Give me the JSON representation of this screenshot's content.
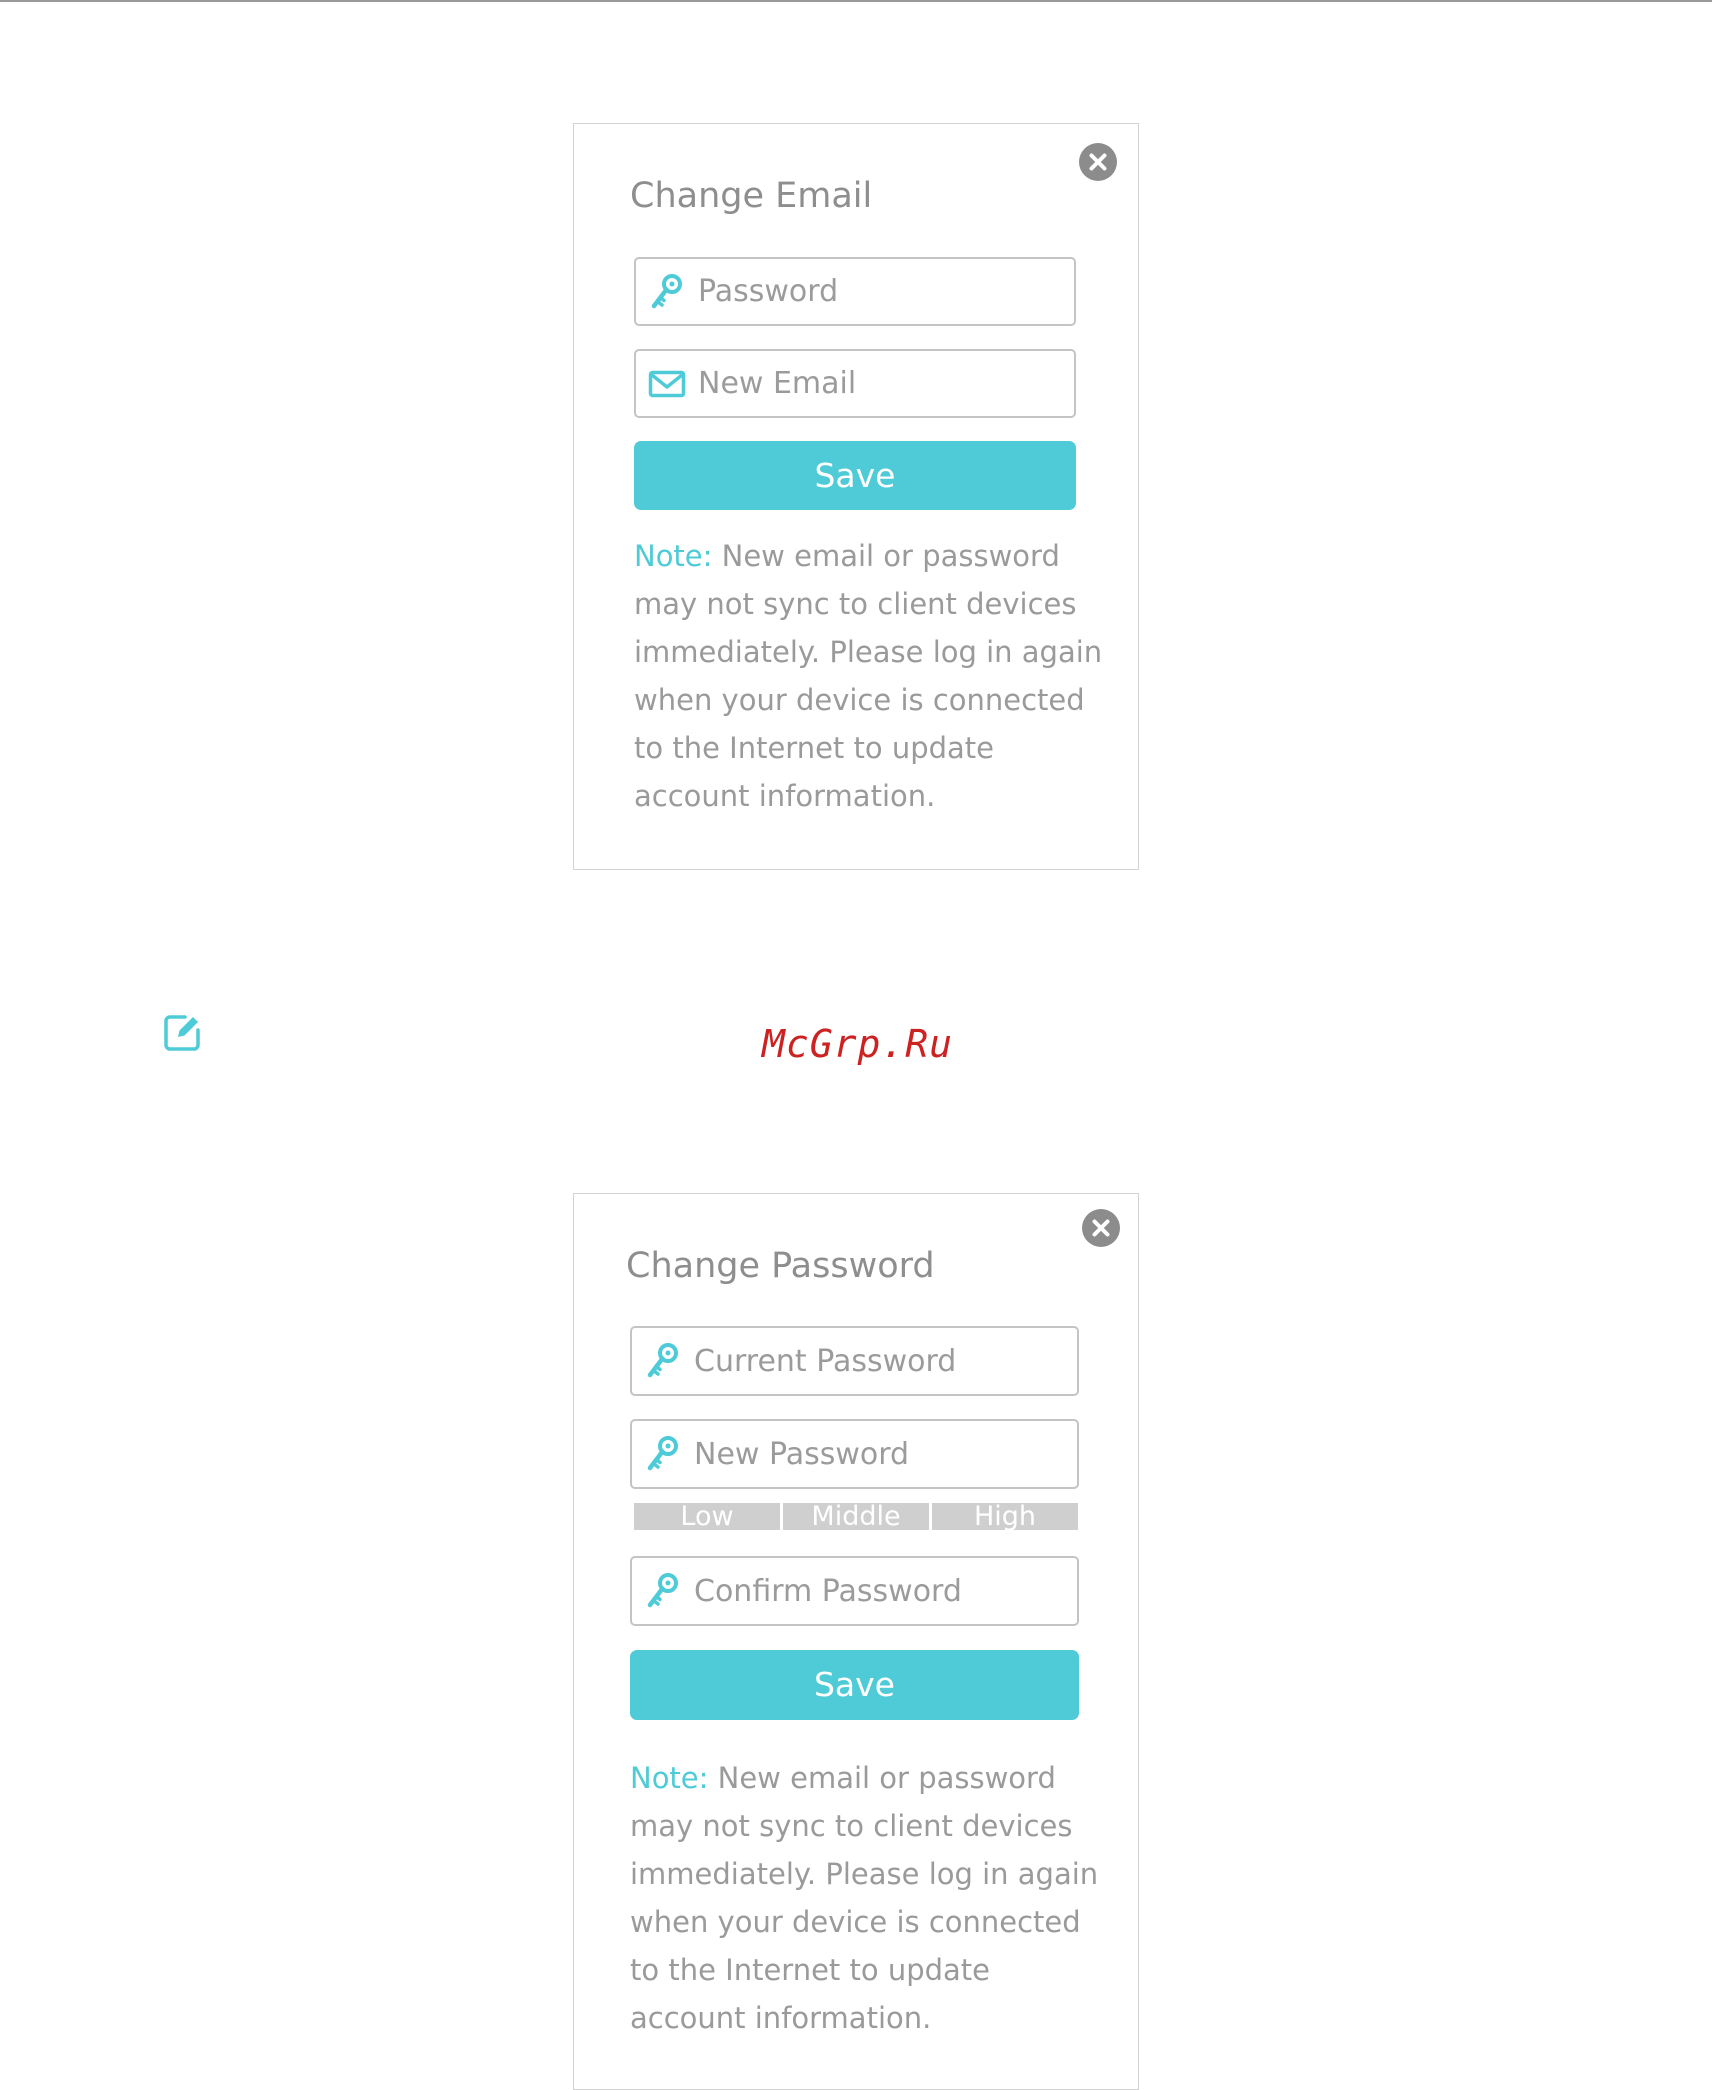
{
  "email_dialog": {
    "title": "Change Email",
    "close_icon": "close-icon",
    "fields": {
      "password": {
        "placeholder": "Password",
        "value": "",
        "icon": "key-icon"
      },
      "new_email": {
        "placeholder": "New Email",
        "value": "",
        "icon": "envelope-icon"
      }
    },
    "save_label": "Save",
    "note": {
      "label": "Note:",
      "lines": [
        " New email or password",
        "may not sync to client devices",
        "immediately. Please log in again",
        "when your device is connected",
        "to the Internet to update",
        "account information."
      ]
    }
  },
  "edit_icon": "edit-icon",
  "watermark": "McGrp.Ru",
  "password_dialog": {
    "title": "Change Password",
    "close_icon": "close-icon",
    "fields": {
      "current_password": {
        "placeholder": "Current Password",
        "value": "",
        "icon": "key-icon"
      },
      "new_password": {
        "placeholder": "New Password",
        "value": "",
        "icon": "key-icon"
      },
      "confirm_password": {
        "placeholder": "Confirm Password",
        "value": "",
        "icon": "key-icon"
      }
    },
    "strength_levels": [
      "Low",
      "Middle",
      "High"
    ],
    "save_label": "Save",
    "note": {
      "label": "Note:",
      "lines": [
        " New email or password",
        "may not sync to client devices",
        "immediately. Please log in again",
        "when your device is connected",
        "to the Internet to update",
        "account information."
      ]
    }
  },
  "colors": {
    "accent": "#4ecbd6",
    "muted_text": "#9a9a9a",
    "border": "#c4c4c4",
    "close_button": "#8c8c8c",
    "strength_bar": "#cfcfcf",
    "watermark": "#cc2222"
  }
}
